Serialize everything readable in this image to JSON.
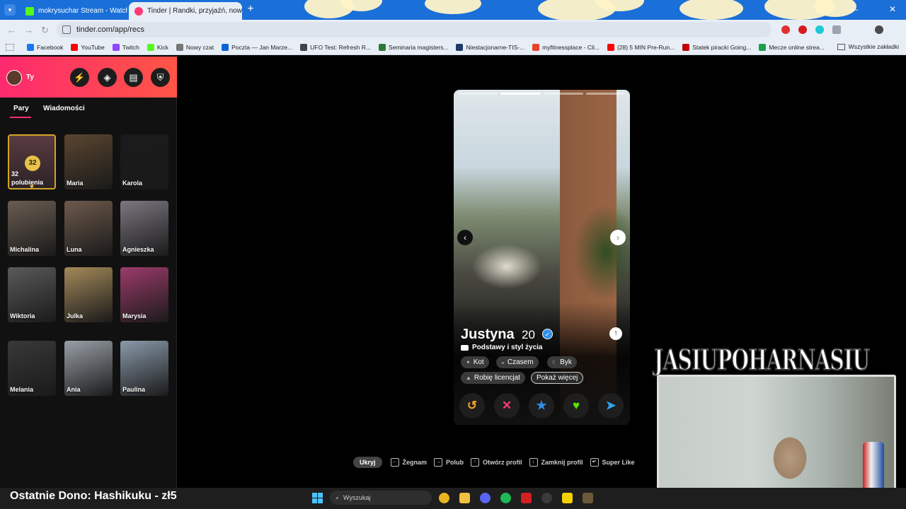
{
  "browser": {
    "tabs": [
      {
        "title": "mokrysuchar Stream - Watch L",
        "active": false,
        "favicon_color": "#53fc18"
      },
      {
        "title": "Tinder | Randki, przyjaźń, nowe",
        "active": true,
        "favicon_color": "#fd3a73"
      }
    ],
    "url": "tinder.com/app/recs",
    "bookmarks": [
      {
        "label": "Facebook",
        "color": "#1877f2"
      },
      {
        "label": "YouTube",
        "color": "#ff0000"
      },
      {
        "label": "Twitch",
        "color": "#9146ff"
      },
      {
        "label": "Kick",
        "color": "#53fc18"
      },
      {
        "label": "Nowy czat",
        "color": "#777777"
      },
      {
        "label": "Poczta — Jan Marze...",
        "color": "#0a64d8"
      },
      {
        "label": "UFO Test: Refresh R...",
        "color": "#444444"
      },
      {
        "label": "Seminaria magisters...",
        "color": "#2a7a3a"
      },
      {
        "label": "Niestacjonarne-TIS-...",
        "color": "#1f3a6a"
      },
      {
        "label": "myfitnessplace - Cli...",
        "color": "#e8442a"
      },
      {
        "label": "(28) 5 MIN Pre-Run...",
        "color": "#ff0000"
      },
      {
        "label": "Statek piracki Going...",
        "color": "#c00000"
      },
      {
        "label": "Mecze online strea...",
        "color": "#19a04b"
      }
    ],
    "all_bookmarks": "Wszystkie zakładki"
  },
  "tinder": {
    "header": {
      "user_label": "Ty"
    },
    "tabs": {
      "matches": "Pary",
      "messages": "Wiadomości"
    },
    "likes": {
      "count": "32",
      "label_line1": "32",
      "label_line2": "polubienia"
    },
    "matches": [
      {
        "name": "Maria",
        "color": "#5a4630"
      },
      {
        "name": "Karola",
        "color": "#1b1b1b"
      },
      {
        "name": "Michalina",
        "color": "#6a5d52"
      },
      {
        "name": "Luna",
        "color": "#6e5a4c"
      },
      {
        "name": "Agnieszka",
        "color": "#7c7780"
      },
      {
        "name": "Wiktoria",
        "color": "#5a5a5a"
      },
      {
        "name": "Julka",
        "color": "#a48a5a"
      },
      {
        "name": "Marysia",
        "color": "#9c3b6a"
      },
      {
        "name": "Melania",
        "color": "#3a3838"
      },
      {
        "name": "Ania",
        "color": "#9aa0a8"
      },
      {
        "name": "Paulina",
        "color": "#8a9aaa"
      }
    ],
    "profile": {
      "name": "Justyna",
      "age": "20",
      "basics_label": "Podstawy i styl życia",
      "chips": [
        "Kot",
        "Czasem",
        "Byk",
        "Robię licencjat"
      ],
      "show_more": "Pokaż więcej",
      "photo_count": 4,
      "photo_index": 1
    },
    "hints": {
      "hide": "Ukryj",
      "items": [
        "Żegnam",
        "Polub",
        "Otwórz profil",
        "Zamknij profil",
        "Super Like"
      ]
    }
  },
  "stream": {
    "title": "JASIUPOHARNASIU",
    "donation": "Ostatnie Dono: Hashikuku - zł5"
  },
  "taskbar": {
    "search_placeholder": "Wyszukaj"
  },
  "colors": {
    "tinder_gradient_start": "#fd2a6f",
    "tinder_gradient_end": "#ff5545",
    "rewind": "#f5a623",
    "nope": "#fd3a73",
    "superlike": "#2f8fea",
    "like": "#5fe300",
    "boost": "#2fa8ea"
  }
}
